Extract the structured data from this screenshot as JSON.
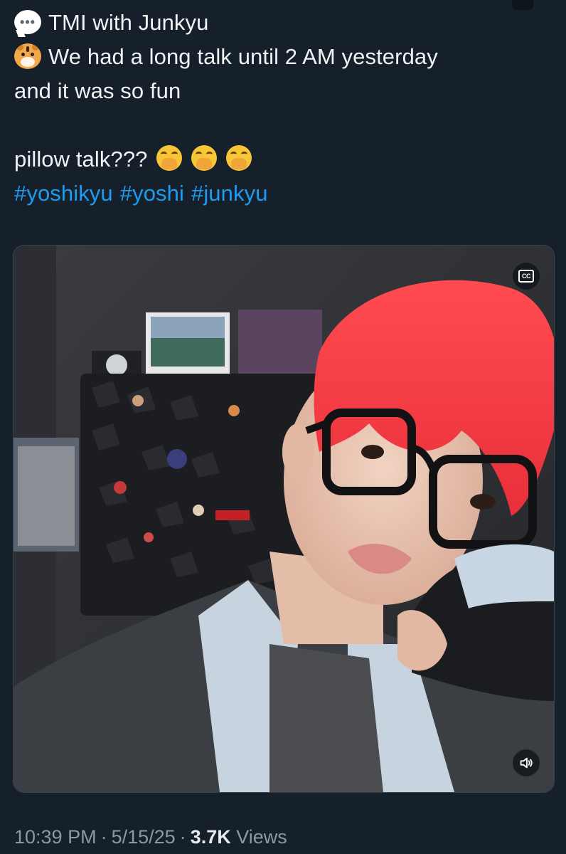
{
  "tweet": {
    "line1": "TMI with Junkyu",
    "line2": "We had a long talk until 2 AM yesterday",
    "line3": "and it was so fun",
    "line4": "pillow talk???",
    "hashtags": [
      "#yoshikyu",
      "#yoshi",
      "#junkyu"
    ],
    "icons": {
      "line1": "speech-bubble-icon",
      "line2": "tiger-face-icon",
      "line4": "face-with-hand-over-mouth-icon"
    }
  },
  "video": {
    "cc_label": "CC",
    "cc_icon": "closed-captions-icon",
    "volume_icon": "speaker-muted-icon"
  },
  "meta": {
    "time": "10:39 PM",
    "separator": "·",
    "date": "5/15/25",
    "views_count": "3.7K",
    "views_label": "Views"
  },
  "colors": {
    "background": "#15202b",
    "text": "#e7e9ea",
    "link": "#1d9bf0",
    "muted": "#8b98a5",
    "hair": "#ef3b43"
  }
}
